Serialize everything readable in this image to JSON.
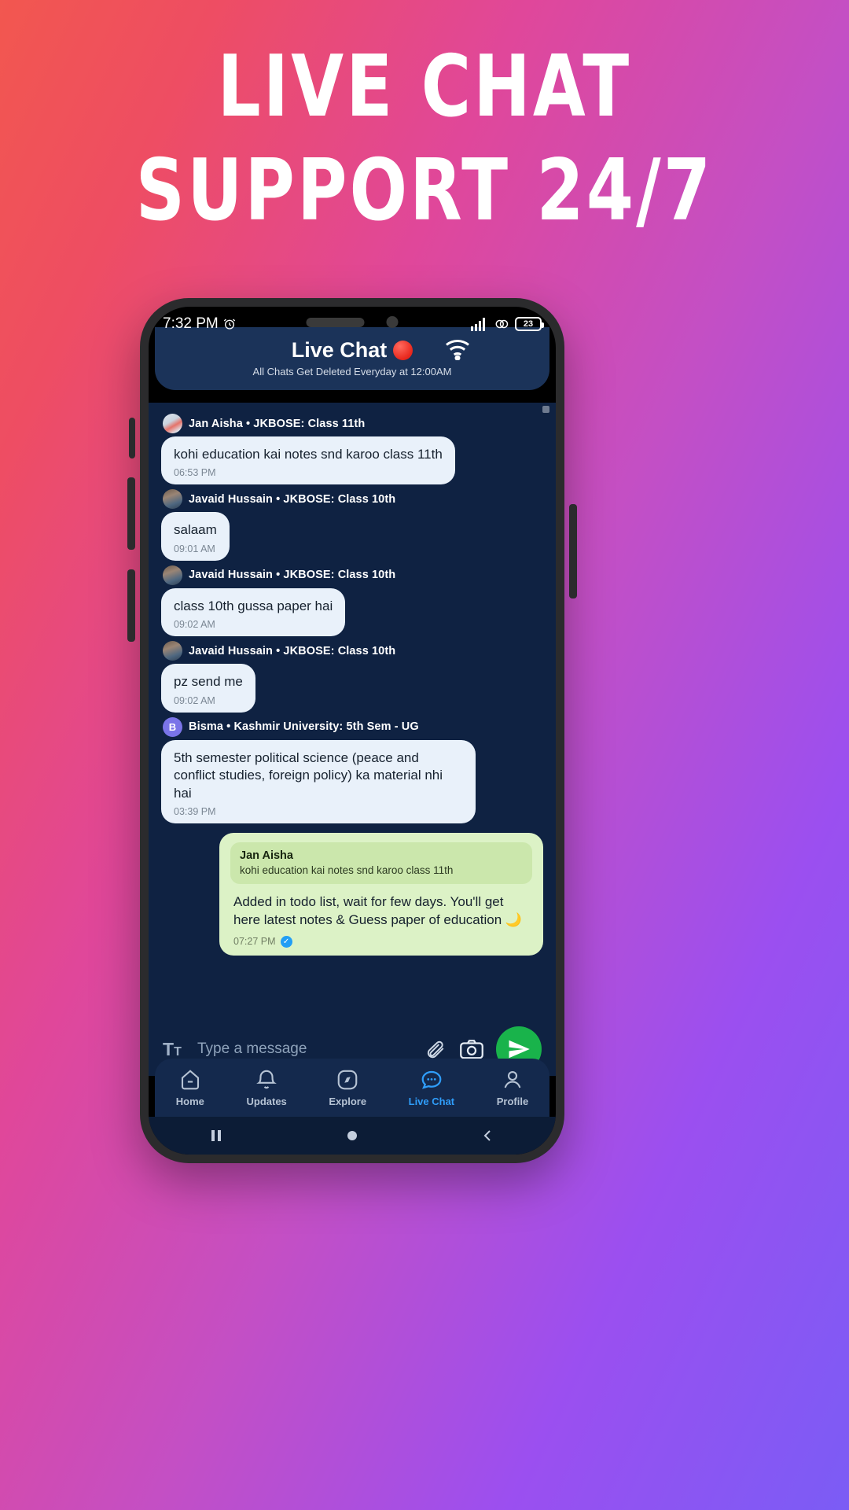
{
  "promo": {
    "line1": "Live Chat",
    "line2": "Support 24/7"
  },
  "statusbar": {
    "time": "7:32 PM",
    "alarm_icon": "alarm-clock-icon",
    "signal_icon": "cellular-signal-icon",
    "dual_sim_icon": "dual-sim-icon",
    "wifi_icon": "wifi-icon",
    "battery_level": "23"
  },
  "header": {
    "title": "Live Chat",
    "record_dot": "red-circle-icon",
    "subtitle": "All Chats Get Deleted Everyday at 12:00AM"
  },
  "messages": [
    {
      "sender": "Jan Aisha • JKBOSE: Class 11th",
      "avatar_class": "av-aisha",
      "avatar_initial": "",
      "text": "kohi education kai notes snd karoo class 11th",
      "time": "06:53 PM",
      "width": "full"
    },
    {
      "sender": "Javaid Hussain • JKBOSE: Class 10th",
      "avatar_class": "av-javaid",
      "avatar_initial": "",
      "text": "salaam",
      "time": "09:01 AM",
      "width": "tiny"
    },
    {
      "sender": "Javaid Hussain • JKBOSE: Class 10th",
      "avatar_class": "av-javaid",
      "avatar_initial": "",
      "text": "class 10th gussa paper hai",
      "time": "09:02 AM",
      "width": "mid"
    },
    {
      "sender": "Javaid Hussain • JKBOSE: Class 10th",
      "avatar_class": "av-javaid",
      "avatar_initial": "",
      "text": "pz send me",
      "time": "09:02 AM",
      "width": "small"
    },
    {
      "sender": "Bisma • Kashmir University: 5th Sem - UG",
      "avatar_class": "av-bisma",
      "avatar_initial": "B",
      "text": "5th semester political science (peace and conflict studies, foreign policy) ka material nhi hai",
      "time": "03:39 PM",
      "width": "full"
    }
  ],
  "outgoing": {
    "quote_name": "Jan Aisha",
    "quote_text": "kohi education kai notes snd karoo class 11th",
    "text": "Added in todo list, wait for few days. You'll get here latest notes & Guess paper of education 🌙",
    "time": "07:27 PM",
    "seen_icon": "blue-check-icon"
  },
  "composer": {
    "format_icon": "text-format-icon",
    "placeholder": "Type a message",
    "value": "",
    "attach_icon": "paperclip-icon",
    "camera_icon": "camera-icon",
    "send_icon": "send-icon"
  },
  "bottomnav": {
    "items": [
      {
        "label": "Home",
        "icon": "home-icon",
        "active": false
      },
      {
        "label": "Updates",
        "icon": "bell-icon",
        "active": false
      },
      {
        "label": "Explore",
        "icon": "compass-icon",
        "active": false
      },
      {
        "label": "Live Chat",
        "icon": "chat-icon",
        "active": true
      },
      {
        "label": "Profile",
        "icon": "person-icon",
        "active": false
      }
    ]
  },
  "androidnav": {
    "recents_icon": "recents-icon",
    "home_icon": "home-circle-icon",
    "back_icon": "back-icon"
  },
  "colors": {
    "accent_blue": "#2f9dfa",
    "send_green": "#19b34b",
    "header_navy": "#1b3359",
    "chat_navy": "#0f2242",
    "bubble_in": "#e9f1fa",
    "bubble_out": "#dcf2c6",
    "rec_red": "#e8271c"
  }
}
